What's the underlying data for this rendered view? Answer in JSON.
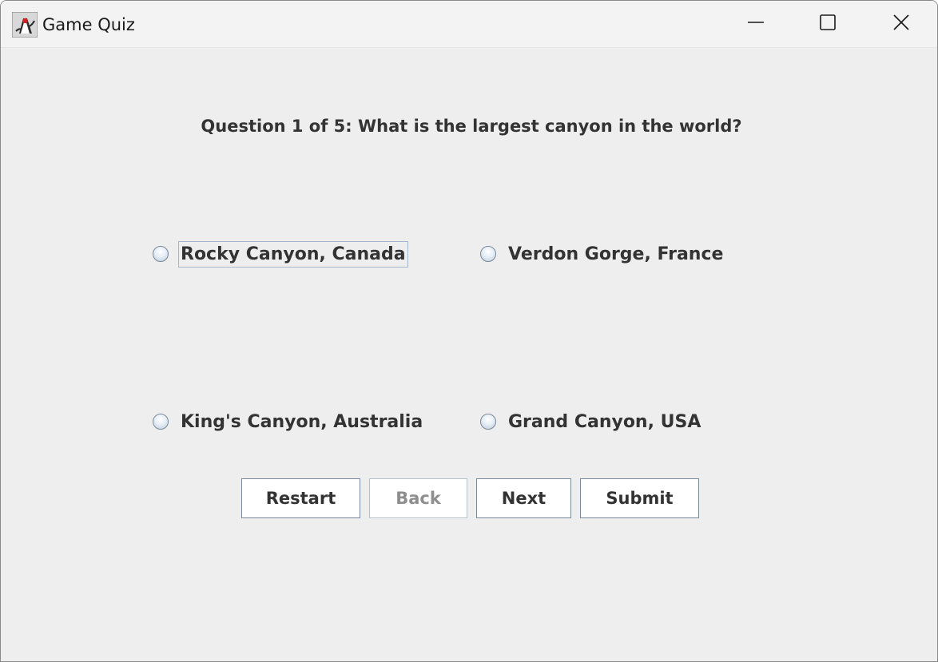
{
  "window": {
    "title": "Game Quiz",
    "icon": "java-duke-icon"
  },
  "window_controls": {
    "minimize": "minimize-icon",
    "maximize": "maximize-icon",
    "close": "close-icon"
  },
  "quiz": {
    "question": "Question 1 of 5: What is the largest canyon in the world?",
    "options": [
      {
        "label": "Rocky Canyon, Canada",
        "selected": false,
        "focused": true
      },
      {
        "label": "Verdon Gorge, France",
        "selected": false,
        "focused": false
      },
      {
        "label": "King's Canyon, Australia",
        "selected": false,
        "focused": false
      },
      {
        "label": "Grand Canyon, USA",
        "selected": false,
        "focused": false
      }
    ]
  },
  "buttons": {
    "restart": {
      "label": "Restart",
      "enabled": true
    },
    "back": {
      "label": "Back",
      "enabled": false
    },
    "next": {
      "label": "Next",
      "enabled": true
    },
    "submit": {
      "label": "Submit",
      "enabled": true
    }
  },
  "colors": {
    "background": "#eeeeee",
    "text": "#333333",
    "disabled_text": "#8e8e8e",
    "focus_border": "#a3b8cc"
  }
}
